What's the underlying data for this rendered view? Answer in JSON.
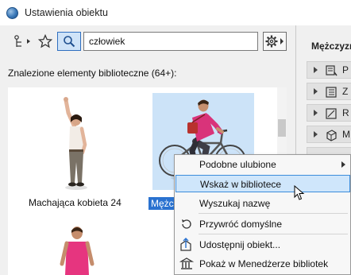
{
  "window": {
    "title": "Ustawienia obiektu"
  },
  "toolbar": {
    "family_icon": "family-tree-icon",
    "favorites_icon": "star-icon",
    "search_icon": "search-icon",
    "search_value": "człowiek",
    "settings_icon": "gear-icon"
  },
  "results": {
    "found_label": "Znalezione elementy biblioteczne (64+):",
    "items": [
      {
        "caption": "Machająca kobieta 24",
        "selected": false
      },
      {
        "caption": "Mężc",
        "selected": true
      },
      {
        "caption": "",
        "selected": false
      }
    ]
  },
  "right_panel": {
    "heading": "Mężczyzna",
    "rows": [
      {
        "label": "P",
        "icon": "preview-icon"
      },
      {
        "label": "Z",
        "icon": "parameters-icon"
      },
      {
        "label": "R",
        "icon": "representation-icon"
      },
      {
        "label": "M",
        "icon": "model-icon"
      }
    ]
  },
  "context_menu": {
    "items": [
      {
        "label": "Podobne ulubione",
        "icon": "",
        "submenu": true,
        "highlighted": false
      },
      {
        "label": "Wskaż w bibliotece",
        "icon": "",
        "submenu": false,
        "highlighted": true
      },
      {
        "label": "Wyszukaj nazwę",
        "icon": "",
        "submenu": false,
        "highlighted": false
      },
      {
        "label": "Przywróć domyślne",
        "icon": "restore-defaults-icon",
        "submenu": false,
        "highlighted": false
      },
      {
        "label": "Udostępnij obiekt...",
        "icon": "share-object-icon",
        "submenu": false,
        "highlighted": false
      },
      {
        "label": "Pokaż w Menedżerze bibliotek",
        "icon": "library-manager-icon",
        "submenu": false,
        "highlighted": false
      }
    ]
  },
  "colors": {
    "selection_fill": "#cce3f8",
    "caption_selected": "#2a72d0",
    "menu_highlight": "#cfe6fb",
    "menu_highlight_border": "#3c8ddb"
  }
}
